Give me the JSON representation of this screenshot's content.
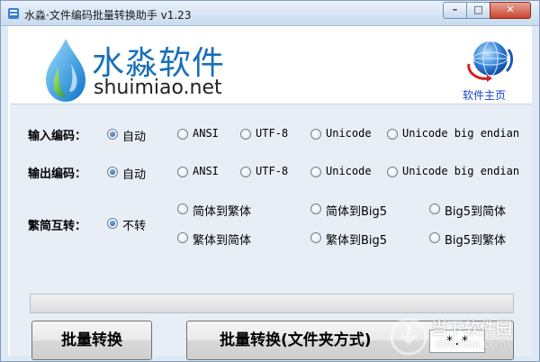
{
  "window": {
    "title": "水淼·文件编码批量转换助手 v1.23",
    "controls": {
      "minimize": "–",
      "maximize": "□",
      "close": "✕"
    }
  },
  "header": {
    "brand_cn": "水淼软件",
    "brand_en": "shuimiao.net",
    "homepage_link": "软件主页"
  },
  "input_encoding": {
    "label": "输入编码：",
    "options": [
      "自动",
      "ANSI",
      "UTF-8",
      "Unicode",
      "Unicode big endian"
    ],
    "selected": "自动"
  },
  "output_encoding": {
    "label": "输出编码：",
    "options": [
      "自动",
      "ANSI",
      "UTF-8",
      "Unicode",
      "Unicode big endian"
    ],
    "selected": "自动"
  },
  "conversion": {
    "label": "繁简互转：",
    "options": [
      "不转",
      "简体到繁体",
      "简体到Big5",
      "Big5到简体",
      "繁体到简体",
      "繁体到Big5",
      "Big5到繁体"
    ],
    "selected": "不转"
  },
  "progress": {
    "value": 0
  },
  "actions": {
    "batch_convert": "批量转换",
    "batch_convert_folder": "批量转换(文件夹方式)",
    "file_pattern": "*.*"
  },
  "watermark": {
    "cn": "当下软件园",
    "en": "downxia.com"
  },
  "colors": {
    "brand_blue": "#1a6fb6",
    "link_blue": "#1541c9",
    "panel_bg": "#e8eef6"
  }
}
